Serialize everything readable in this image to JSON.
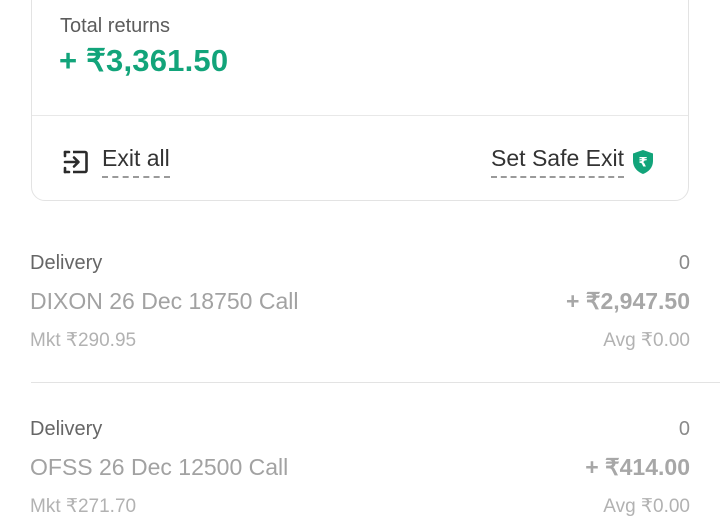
{
  "summary": {
    "total_returns_label": "Total returns",
    "total_returns_value": "+ ₹3,361.50",
    "accent_color": "#12a47a"
  },
  "actions": {
    "exit_all_label": "Exit all",
    "exit_all_icon": "exit-icon",
    "safe_exit_label": "Set Safe Exit",
    "safe_exit_icon": "rupee-shield-icon",
    "shield_glyph": "₹"
  },
  "positions": [
    {
      "type": "Delivery",
      "qty": "0",
      "name": "DIXON 26 Dec 18750 Call",
      "pnl": "+ ₹2,947.50",
      "mkt": "Mkt ₹290.95",
      "avg": "Avg ₹0.00"
    },
    {
      "type": "Delivery",
      "qty": "0",
      "name": "OFSS 26 Dec 12500 Call",
      "pnl": "+ ₹414.00",
      "mkt": "Mkt ₹271.70",
      "avg": "Avg ₹0.00"
    }
  ]
}
